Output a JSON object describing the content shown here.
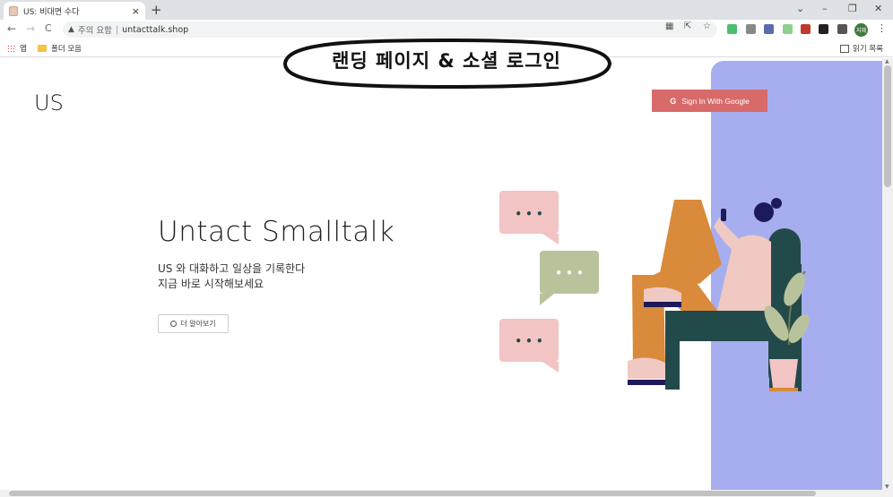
{
  "browser": {
    "tab_title": "US: 비대면 수다",
    "tab_close": "×",
    "new_tab": "+",
    "window_controls": [
      "⌄",
      "–",
      "❐",
      "✕"
    ],
    "nav": {
      "back": "←",
      "forward": "→",
      "reload": "C"
    },
    "address": {
      "security_label": "주의 요함",
      "separator": "|",
      "url": "untacttalk.shop"
    },
    "avatar_label": "지혜",
    "menu": "⋮",
    "bookmarks": {
      "apps_label": "앱",
      "folder_label": "폴더 모음",
      "reading_list": "읽기 목록"
    }
  },
  "page": {
    "logo": "US",
    "sign_in_button": "Sign In With Google",
    "google_glyph": "G",
    "hero_title": "Untact Smalltalk",
    "hero_subtitle_line1": "US 와 대화하고 일상을 기록한다",
    "hero_subtitle_line2": "지금 바로 시작해보세요",
    "learn_more_button": "더 알아보기",
    "chat_bubble_text": "• • •"
  },
  "banner": {
    "text": "랜딩 페이지 & 소셜 로그인"
  },
  "colors": {
    "blue_panel": "#a6aeef",
    "google_button": "#d86a6a",
    "bubble_pink": "#f2c4c4",
    "bubble_green": "#b8c39c",
    "chair_dark": "#234a4a",
    "pants_orange": "#d98a3a",
    "shirt_pink": "#f0c9c2",
    "hair_navy": "#1d1a5c"
  }
}
